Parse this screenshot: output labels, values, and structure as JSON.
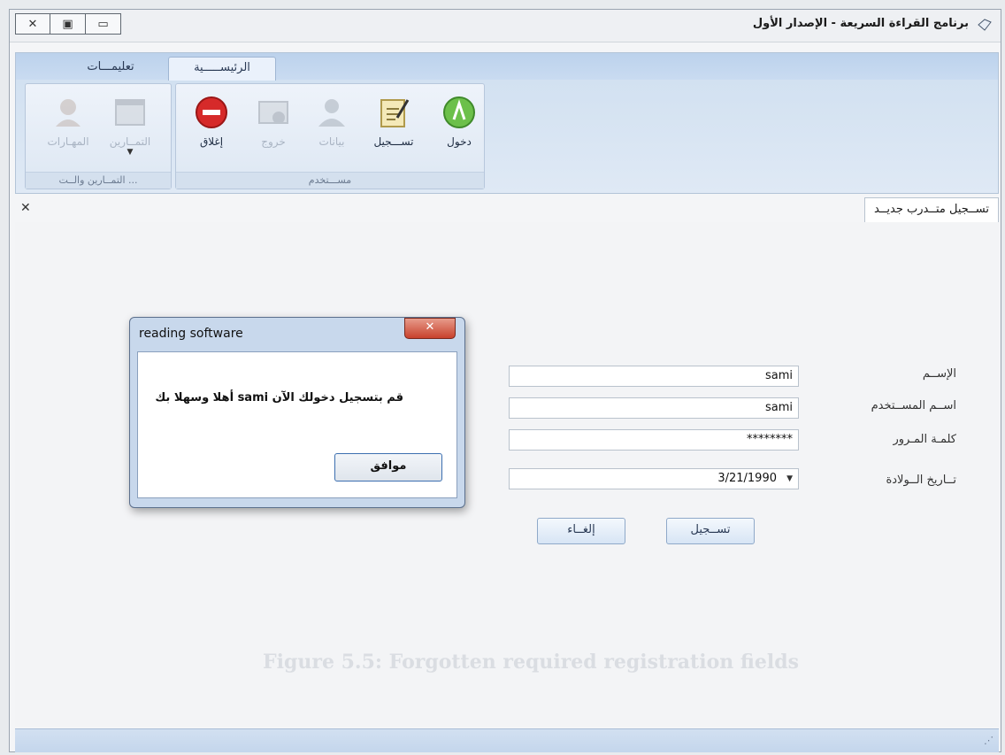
{
  "window": {
    "title": "برنامج القراءة السريعة - الإصدار الأول"
  },
  "ribbon": {
    "tabs": [
      {
        "label": "الرئيســـــية",
        "active": true
      },
      {
        "label": "تعليمـــات",
        "active": false
      }
    ],
    "user_group": {
      "label": "مســـتخدم",
      "buttons": [
        {
          "label": "دخول",
          "icon": "login-icon",
          "enabled": true
        },
        {
          "label": "تســـجيل",
          "icon": "register-icon",
          "enabled": true
        },
        {
          "label": "بيانات",
          "icon": "user-icon",
          "enabled": false
        },
        {
          "label": "خروج",
          "icon": "logout-icon",
          "enabled": false
        },
        {
          "label": "إغلاق",
          "icon": "close-app-icon",
          "enabled": true
        }
      ]
    },
    "exercises_group": {
      "label": "... التمــارين والــت",
      "buttons": [
        {
          "label": "التمــارين",
          "icon": "exercises-icon",
          "enabled": false
        },
        {
          "label": "المهـارات",
          "icon": "skills-icon",
          "enabled": false
        }
      ]
    }
  },
  "doc_tab": {
    "label": "تســجيل متــدرب جديــد"
  },
  "form": {
    "name_label": "الإســم",
    "name_value": "sami",
    "username_label": "اســم المســتخدم",
    "username_value": "sami",
    "password_label": "كلمـة المـرور",
    "password_value": "********",
    "birthdate_label": "تــاريخ الــولادة",
    "birthdate_value": "3/21/1990",
    "register_button": "تســجيل",
    "cancel_button": "إلغــاء"
  },
  "watermark": "Figure 5.5: Forgotten required registration fields",
  "dialog": {
    "title": "reading software",
    "message": "قم بتسجيل دخولك الآن sami أهلا وسهلا بك",
    "ok_button": "موافق"
  },
  "colors": {
    "accent": "#3c6fb0",
    "ribbon": "#cfdff0",
    "dialog_close": "#c8412c"
  }
}
